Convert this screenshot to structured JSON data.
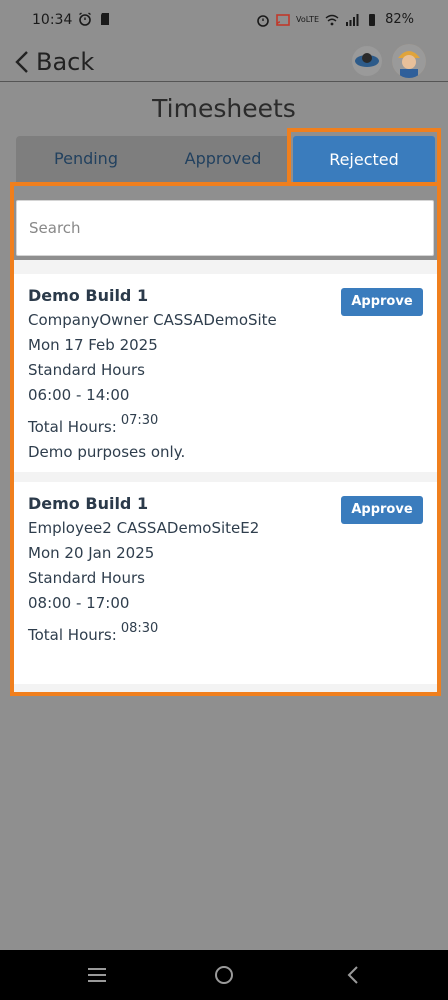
{
  "status": {
    "time": "10:34",
    "battery": "82%",
    "network": "VoLTE"
  },
  "nav": {
    "back_label": "Back"
  },
  "page": {
    "title": "Timesheets"
  },
  "tabs": [
    {
      "label": "Pending",
      "active": false
    },
    {
      "label": "Approved",
      "active": false
    },
    {
      "label": "Rejected",
      "active": true
    }
  ],
  "search": {
    "placeholder": "Search",
    "value": ""
  },
  "timesheets": [
    {
      "title": "Demo Build 1",
      "person": "CompanyOwner CASSADemoSite",
      "date": "Mon 17 Feb 2025",
      "type": "Standard Hours",
      "time_range": "06:00 - 14:00",
      "total_label": "Total Hours:",
      "total_value": "07:30",
      "note": "Demo purposes only.",
      "action_label": "Approve"
    },
    {
      "title": "Demo Build 1",
      "person": "Employee2 CASSADemoSiteE2",
      "date": "Mon 20 Jan 2025",
      "type": "Standard Hours",
      "time_range": "08:00 - 17:00",
      "total_label": "Total Hours:",
      "total_value": "08:30",
      "note": "",
      "action_label": "Approve"
    }
  ],
  "colors": {
    "accent": "#3a7cbd",
    "highlight": "#f07f1d",
    "background": "#8f8f8f"
  },
  "icons": [
    "alarm-icon",
    "sd-card-icon",
    "cast-icon",
    "wifi-icon",
    "signal-icon",
    "battery-icon",
    "chevron-left-icon",
    "menu-icon",
    "home-icon",
    "back-triangle-icon"
  ]
}
